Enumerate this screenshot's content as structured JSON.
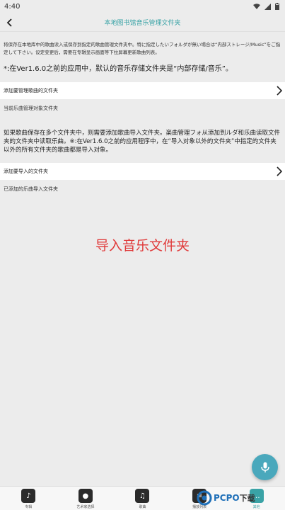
{
  "status": {
    "time": "4:40"
  },
  "header": {
    "title": "本地图书馆音乐管理文件夹"
  },
  "notes": {
    "jp": "将保存在本地库中的歌曲读入或保存到指定的歌曲管理文件夹中。特に指定したいフォルダが無い場合は“内部ストレージ/Music”をご指定して下さい。设定变更后，需要在专辑显示画面等下拉屏幕更新歌曲列表。",
    "cn": "*:在Ver1.6.0之前的应用中，默认的音乐存储文件夹是“内部存储/音乐”。"
  },
  "rows": {
    "add_manage": "添加要管理歌曲的文件夹",
    "current_target": "当前乐曲管理对象文件夹",
    "add_import": "添加要导入的文件夹",
    "added_import": "已添加的乐曲导入文件夹"
  },
  "description": "如果歌曲保存在多个文件夹中，则需要添加歌曲导入文件夹。楽曲管理フォ从添加到ルダ和乐曲读取文件夹的文件夹中读取乐曲。※:在Ver1.6.0之前的应用程序中，在“导入对象以外的文件夹”中指定的文件夹以外的所有文件夹的歌曲都是导入对象。",
  "overlay_label": "导入音乐文件夹",
  "bottom_nav": [
    {
      "label": "专辑"
    },
    {
      "label": "艺术家选择"
    },
    {
      "label": "歌曲"
    },
    {
      "label": "播放列表"
    },
    {
      "label": "其他"
    }
  ],
  "watermark": {
    "brand": "PCPO",
    "suffix": "下载"
  },
  "colors": {
    "accent": "#3aa3a6",
    "fab": "#4aa8bc",
    "overlay_text": "#e03a3a"
  }
}
